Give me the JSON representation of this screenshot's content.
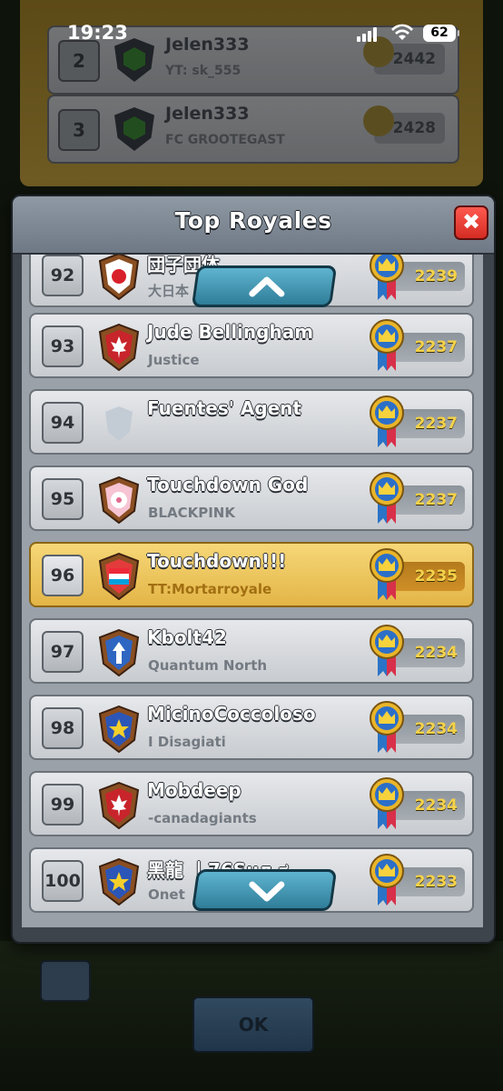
{
  "status_bar": {
    "time": "19:23",
    "battery": "62"
  },
  "background": {
    "rows": [
      {
        "rank": "2",
        "name": "Jelen333",
        "clan": "YT: sk_555",
        "trophies": "2442"
      },
      {
        "rank": "3",
        "name": "Jelen333",
        "clan": "FC GROOTEGAST",
        "trophies": "2428"
      }
    ],
    "ok_label": "OK"
  },
  "modal": {
    "title": "Top Royales",
    "close_label": "✖",
    "rows": [
      {
        "rank": "92",
        "name": "団子団体",
        "clan": "大日本",
        "trophies": "2239",
        "badge_color": "#ffffff",
        "badge_icon": "red-circle-icon"
      },
      {
        "rank": "93",
        "name": "Jude Bellingham",
        "clan": "Justice",
        "trophies": "2237",
        "badge_color": "#c8242b",
        "badge_icon": "maple-leaf-icon"
      },
      {
        "rank": "94",
        "name": "Fuentes' Agent",
        "clan": "",
        "trophies": "2237",
        "badge_color": "#b8c1cc",
        "badge_icon": "empty-badge-icon"
      },
      {
        "rank": "95",
        "name": "Touchdown God",
        "clan": "BLACKPINK",
        "trophies": "2237",
        "badge_color": "#f6c4d2",
        "badge_icon": "cherry-blossom-icon"
      },
      {
        "rank": "96",
        "name": "Touchdown!!!",
        "clan": "TT:Mortarroyale",
        "trophies": "2235",
        "badge_color": "#e33b3b",
        "badge_icon": "luxembourg-flag-icon"
      },
      {
        "rank": "97",
        "name": "Kbolt42",
        "clan": "Quantum North",
        "trophies": "2234",
        "badge_color": "#2f66c2",
        "badge_icon": "arrow-up-icon"
      },
      {
        "rank": "98",
        "name": "MicinoCoccoloso",
        "clan": "I Disagiati",
        "trophies": "2234",
        "badge_color": "#2b56b8",
        "badge_icon": "star-icon"
      },
      {
        "rank": "99",
        "name": "Mobdeep",
        "clan": "-canadagiants",
        "trophies": "2234",
        "badge_color": "#c8242b",
        "badge_icon": "maple-leaf-icon"
      },
      {
        "rank": "100",
        "name": "黑龍 丨76Ѕнл.ಠ",
        "clan": "Onet",
        "trophies": "2233",
        "badge_color": "#2b56b8",
        "badge_icon": "star-icon"
      }
    ]
  },
  "colors": {
    "accent_gold": "#f5d24a",
    "highlight_row": "#f6d777",
    "scroll_button": "#3f97b5",
    "close_button": "#d42c23"
  }
}
